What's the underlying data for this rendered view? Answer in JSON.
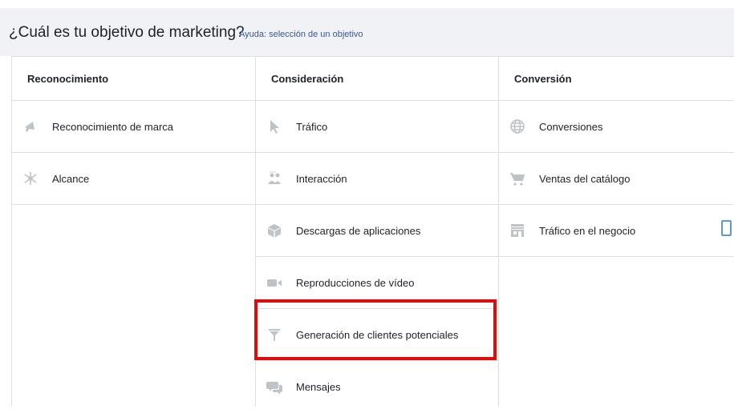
{
  "header": {
    "question": "¿Cuál es tu objetivo de marketing?",
    "help_link": "Ayuda: selección de un objetivo"
  },
  "columns": [
    {
      "title": "Reconocimiento",
      "items": [
        {
          "label": "Reconocimiento de marca",
          "icon": "megaphone-icon"
        },
        {
          "label": "Alcance",
          "icon": "reach-icon"
        }
      ]
    },
    {
      "title": "Consideración",
      "items": [
        {
          "label": "Tráfico",
          "icon": "cursor-icon"
        },
        {
          "label": "Interacción",
          "icon": "people-icon"
        },
        {
          "label": "Descargas de aplicaciones",
          "icon": "box-icon"
        },
        {
          "label": "Reproducciones de vídeo",
          "icon": "video-camera-icon"
        },
        {
          "label": "Generación de clientes potenciales",
          "icon": "funnel-icon"
        },
        {
          "label": "Mensajes",
          "icon": "chat-bubbles-icon"
        }
      ]
    },
    {
      "title": "Conversión",
      "items": [
        {
          "label": "Conversiones",
          "icon": "globe-icon"
        },
        {
          "label": "Ventas del catálogo",
          "icon": "shopping-cart-icon"
        },
        {
          "label": "Tráfico en el negocio",
          "icon": "store-icon"
        }
      ]
    }
  ],
  "colors": {
    "icon_gray": "#bec3c9",
    "highlight": "#e10b0b",
    "border": "#dddfe2",
    "header_bg": "#f1f2f6",
    "link": "#365899"
  }
}
